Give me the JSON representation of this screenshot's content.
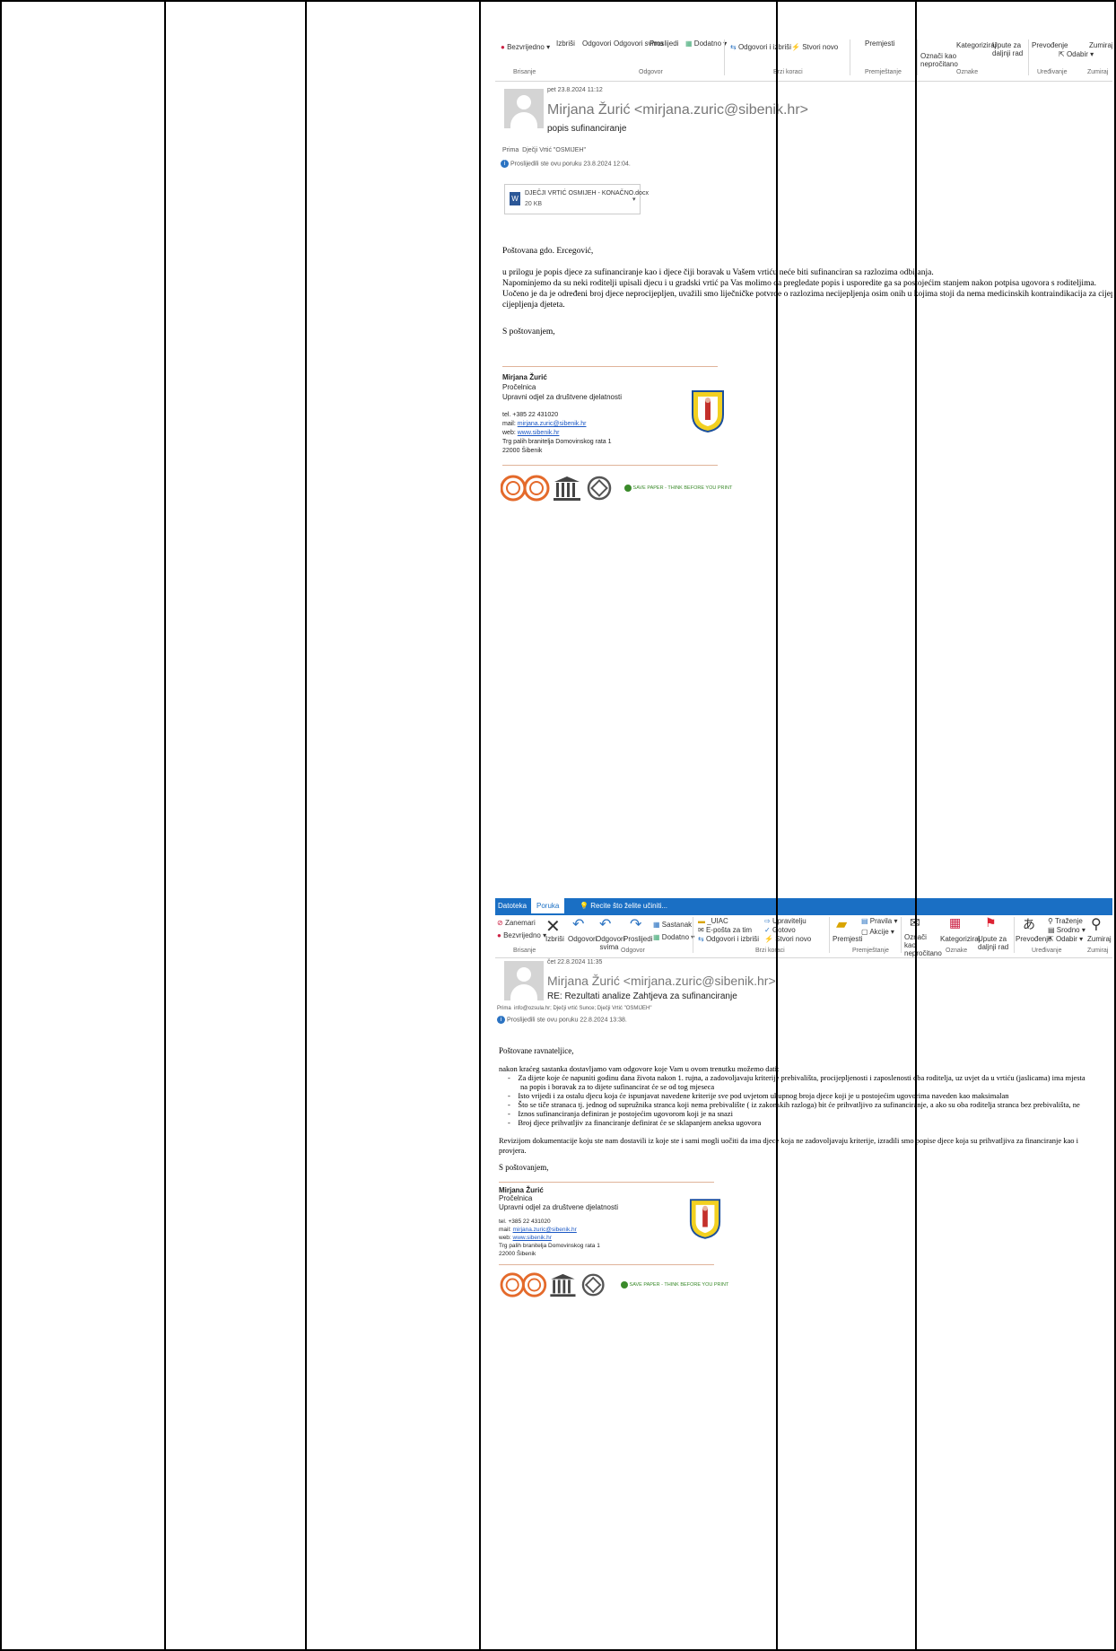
{
  "top_email": {
    "ribbon": {
      "buttons": [
        "Bezvrijedno",
        "Izbriši",
        "Odgovori",
        "Odgovori svima",
        "Proslijedi",
        "Dodatno",
        "Odgovori i izbriši",
        "Stvori novo",
        "Premjesti",
        "Označi kao nepročitano",
        "Kategoriziraj",
        "Upute za daljnji rad",
        "Prevođenje",
        "Odabir",
        "Zumiraj"
      ],
      "groups": [
        "Brisanje",
        "Odgovor",
        "Brzi koraci",
        "Premještanje",
        "Oznake",
        "Uređivanje",
        "Zumiraj"
      ]
    },
    "date": "pet 23.8.2024 11:12",
    "sender": "Mirjana Žurić <mirjana.zuric@sibenik.hr>",
    "subject": "popis sufinanciranje",
    "to_label": "Prima",
    "to": "Dječji Vrtić \"OSMIJEH\"",
    "forwarded": "Proslijedili ste ovu poruku 23.8.2024 12:04.",
    "attachment": {
      "name": "DJEČJI VRTIĆ OSMIJEH - KONAČNO.docx",
      "size": "20 KB"
    },
    "greeting": "Poštovana gdo. Ercegović,",
    "body": [
      "u prilogu je popis djece za sufinanciranje kao i djece čiji boravak u Vašem vrtiću neće biti sufinanciran sa razlozima odbijanja.",
      "Napominjemo da su neki roditelji upisali djecu i u gradski vrtić pa Vas molimo da pregledate popis i usporedite ga sa postojećim stanjem nakon potpisa ugovora s roditeljima.",
      "Uočeno je da je određeni broj djece neprocijepljen, uvažili smo liječničke potvrde o razlozima necijepljenja osim onih u kojima stoji da nema medicinskih kontraindikacija za cijepljenje. Sljedeće",
      "cijepljenja djeteta."
    ],
    "closing": "S poštovanjem,",
    "signature": {
      "name": "Mirjana Žurić",
      "title": "Pročelnica",
      "dept": "Upravni odjel za društvene djelatnosti",
      "tel": "tel. +385 22 431020",
      "mail_label": "mail:",
      "mail": "mirjana.zuric@sibenik.hr",
      "web_label": "web:",
      "web": "www.sibenik.hr",
      "addr1": "Trg palih branitelja Domovinskog rata 1",
      "addr2": "22000 Šibenik",
      "save_paper": "SAVE PAPER - THINK BEFORE YOU PRINT"
    }
  },
  "bottom_email": {
    "tabs": [
      "Datoteka",
      "Poruka",
      "Recite što želite učiniti..."
    ],
    "ribbon": {
      "buttons": [
        "Zanemari",
        "Bezvrijedno",
        "Izbriši",
        "Odgovori",
        "Odgovori svima",
        "Proslijedi",
        "Sastanak",
        "Dodatno",
        "_UIAC",
        "E-pošta za tim",
        "Odgovori i izbriši",
        "Upravitelju",
        "Gotovo",
        "Stvori novo",
        "Premjesti",
        "Pravila",
        "Akcije",
        "Označi kao nepročitano",
        "Kategoriziraj",
        "Upute za daljnji rad",
        "Prevođenje",
        "Traženje",
        "Srodno",
        "Odabir",
        "Zumiraj"
      ],
      "groups": [
        "Brisanje",
        "Odgovor",
        "Brzi koraci",
        "Premještanje",
        "Oznake",
        "Uređivanje",
        "Zumiraj"
      ]
    },
    "date": "čet 22.8.2024 11:35",
    "sender": "Mirjana Žurić <mirjana.zuric@sibenik.hr>",
    "subject": "RE: Rezultati analize Zahtjeva za sufinanciranje",
    "to_label": "Prima",
    "to": "info@ozsula.hr; Dječji vrtić Sunce; Dječji Vrtić \"OSMIJEH\"",
    "forwarded": "Proslijedili ste ovu poruku 22.8.2024 13:38.",
    "greeting": "Poštovane ravnateljice,",
    "intro": "nakon kraćeg sastanka dostavljamo vam odgovore koje Vam u ovom trenutku možemo dati:",
    "bullets": [
      "Za dijete koje će napuniti godinu dana života nakon 1. rujna, a zadovoljavaju kriterije prebivališta, procijepljenosti i zaposlenosti oba roditelja, uz uvjet da u vrtiću (jaslicama) ima mjesta",
      "na popis i boravak za to dijete sufinancirat će se od tog mjeseca",
      "Isto vrijedi i za ostalu djecu koja će ispunjavat navedene kriterije sve pod uvjetom ukupnog broja djece koji je u postojećim ugovorima naveden kao maksimalan",
      "Što se tiče stranaca tj. jednog od supružnika stranca koji nema prebivalište ( iz zakonskih razloga) bit će prihvatljivo za sufinanciranje, a ako su oba roditelja stranca bez prebivališta, ne",
      "Iznos sufinanciranja definiran je postojećim ugovorom koji je na snazi",
      "Broj djece prihvatljiv za financiranje definirat će se sklapanjem aneksa ugovora"
    ],
    "para": [
      "Revizijom dokumentacije koju ste nam dostavili iz koje ste i sami mogli uočiti da ima djece koja ne zadovoljavaju kriterije, izradili smo popise djece koja su prihvatljiva za financiranje kao i",
      "provjera."
    ],
    "closing": "S poštovanjem,",
    "signature": {
      "name": "Mirjana Žurić",
      "title": "Pročelnica",
      "dept": "Upravni odjel za društvene djelatnosti",
      "tel": "tel. +385 22 431020",
      "mail_label": "mail:",
      "mail": "mirjana.zuric@sibenik.hr",
      "web_label": "web:",
      "web": "www.sibenik.hr",
      "addr1": "Trg palih branitelja Domovinskog rata 1",
      "addr2": "22000 Šibenik",
      "save_paper": "SAVE PAPER - THINK BEFORE YOU PRINT"
    }
  },
  "colors": {
    "ribbon_blue": "#1a6fc4",
    "link": "#1a57c4",
    "rule": "#e0b39a",
    "logo_orange": "#e46a2b",
    "green": "#3a8a2a"
  }
}
